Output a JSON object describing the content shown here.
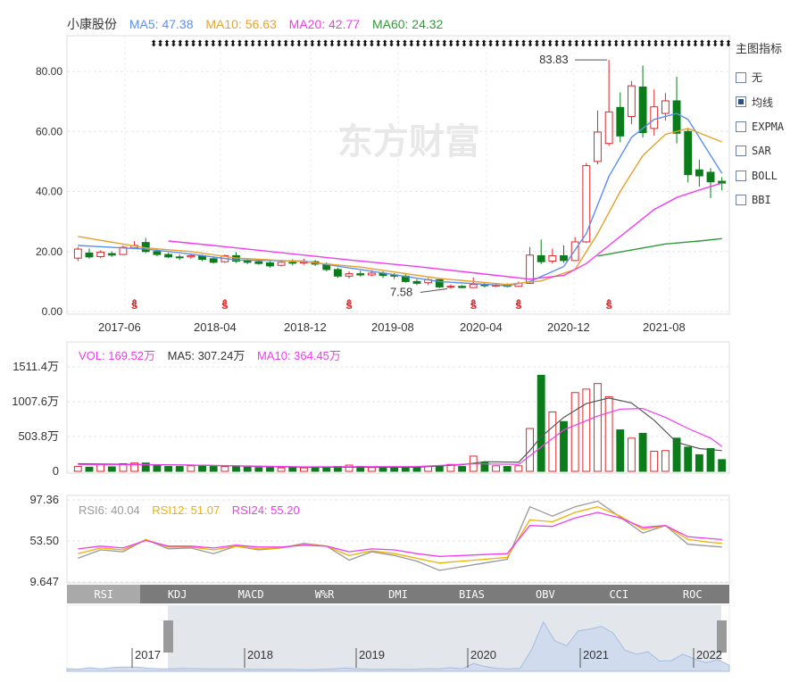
{
  "stock": {
    "name": "小康股份",
    "ma5": "MA5: 47.38",
    "ma10": "MA10: 56.63",
    "ma20": "MA20: 42.77",
    "ma60": "MA60: 24.32"
  },
  "colors": {
    "up": "#e0252b",
    "down": "#0a7d1a",
    "ma5": "#5b8ff0",
    "ma10": "#e6a22e",
    "ma20": "#f03cf0",
    "ma60": "#2f9a3a",
    "rsi6": "#999999",
    "rsi12": "#f0b000",
    "rsi24": "#f03cf0"
  },
  "side_panel": {
    "title": "主图指标",
    "options": [
      {
        "label": "无",
        "checked": false
      },
      {
        "label": "均线",
        "checked": true
      },
      {
        "label": "EXPMA",
        "checked": false
      },
      {
        "label": "SAR",
        "checked": false
      },
      {
        "label": "BOLL",
        "checked": false
      },
      {
        "label": "BBI",
        "checked": false
      }
    ]
  },
  "watermark": "东方财富",
  "volume_legend": {
    "vol": "VOL: 169.52万",
    "ma5": "MA5: 307.24万",
    "ma10": "MA10: 364.45万"
  },
  "rsi_legend": {
    "rsi6": "RSI6: 40.04",
    "rsi12": "RSI12: 51.07",
    "rsi24": "RSI24: 55.20"
  },
  "tabs": [
    "RSI",
    "KDJ",
    "MACD",
    "W%R",
    "DMI",
    "BIAS",
    "OBV",
    "CCI",
    "ROC"
  ],
  "active_tab": "RSI",
  "navigator_years": [
    "2017",
    "2018",
    "2019",
    "2020",
    "2021",
    "2022"
  ],
  "chart_data": [
    {
      "type": "candlestick",
      "y_ticks": [
        "80.00",
        "60.00",
        "40.00",
        "20.00",
        "0.00"
      ],
      "ylim": [
        0,
        90
      ],
      "x_ticks": [
        "2017-06",
        "2018-04",
        "2018-12",
        "2019-08",
        "2020-04",
        "2020-12",
        "2021-08"
      ],
      "annotations": [
        {
          "label": "83.83",
          "index": 47,
          "value": 83.83
        },
        {
          "label": "7.58",
          "index": 33,
          "value": 7.58
        }
      ],
      "dividend_marks": [
        5,
        13,
        24,
        35,
        39,
        47
      ],
      "candles": [
        [
          17.8,
          20.8,
          21.5,
          16.8
        ],
        [
          19.5,
          18.2,
          21.0,
          17.6
        ],
        [
          18.3,
          19.8,
          20.4,
          17.8
        ],
        [
          19.3,
          18.8,
          20.0,
          18.2
        ],
        [
          19.0,
          21.4,
          22.0,
          18.8
        ],
        [
          21.2,
          22.0,
          23.5,
          20.8
        ],
        [
          23.0,
          20.0,
          24.5,
          19.5
        ],
        [
          20.0,
          19.0,
          20.6,
          18.4
        ],
        [
          19.0,
          18.2,
          19.6,
          17.8
        ],
        [
          18.2,
          18.0,
          19.0,
          17.2
        ],
        [
          18.2,
          18.6,
          19.4,
          17.6
        ],
        [
          18.6,
          17.4,
          19.0,
          16.8
        ],
        [
          17.6,
          16.4,
          18.4,
          16.0
        ],
        [
          16.6,
          18.6,
          19.0,
          16.2
        ],
        [
          18.6,
          16.8,
          19.8,
          16.2
        ],
        [
          16.8,
          16.4,
          17.6,
          15.8
        ],
        [
          16.6,
          16.0,
          17.4,
          15.6
        ],
        [
          16.2,
          15.2,
          16.8,
          14.6
        ],
        [
          15.4,
          16.4,
          17.2,
          15.0
        ],
        [
          16.4,
          16.2,
          17.4,
          15.4
        ],
        [
          16.2,
          16.6,
          17.6,
          15.6
        ],
        [
          16.6,
          15.8,
          17.2,
          15.2
        ],
        [
          15.8,
          14.0,
          16.4,
          13.4
        ],
        [
          14.0,
          11.8,
          14.6,
          11.2
        ],
        [
          11.8,
          12.6,
          13.4,
          11.0
        ],
        [
          12.6,
          12.2,
          13.6,
          11.6
        ],
        [
          12.2,
          12.8,
          13.8,
          11.8
        ],
        [
          12.8,
          12.0,
          13.4,
          11.2
        ],
        [
          12.2,
          11.8,
          12.8,
          10.8
        ],
        [
          11.8,
          10.0,
          12.4,
          9.6
        ],
        [
          10.0,
          9.4,
          10.8,
          8.8
        ],
        [
          9.6,
          10.6,
          11.2,
          8.8
        ],
        [
          10.6,
          8.2,
          11.0,
          7.8
        ],
        [
          8.2,
          8.4,
          9.0,
          7.58
        ],
        [
          8.4,
          8.0,
          8.8,
          7.7
        ],
        [
          8.0,
          9.0,
          11.4,
          7.9
        ],
        [
          9.0,
          8.6,
          9.6,
          8.0
        ],
        [
          8.6,
          8.8,
          9.4,
          8.2
        ],
        [
          8.8,
          8.4,
          9.4,
          8.0
        ],
        [
          8.4,
          9.4,
          10.0,
          8.2
        ],
        [
          9.4,
          18.8,
          21.5,
          9.2
        ],
        [
          18.6,
          16.6,
          24.0,
          15.8
        ],
        [
          16.8,
          18.6,
          21.0,
          16.0
        ],
        [
          18.6,
          17.0,
          22.0,
          16.2
        ],
        [
          17.0,
          23.2,
          24.8,
          16.8
        ],
        [
          23.2,
          48.6,
          49.5,
          22.8
        ],
        [
          50.0,
          59.8,
          67.0,
          49.0
        ],
        [
          56.0,
          66.5,
          83.83,
          55.2
        ],
        [
          68.0,
          58.5,
          73.0,
          56.4
        ],
        [
          65.0,
          75.2,
          76.8,
          62.4
        ],
        [
          74.8,
          59.6,
          82.0,
          58.0
        ],
        [
          61.0,
          68.2,
          74.0,
          58.6
        ],
        [
          66.0,
          70.2,
          72.8,
          63.6
        ],
        [
          70.2,
          59.4,
          78.2,
          56.0
        ],
        [
          60.0,
          45.6,
          60.8,
          43.0
        ],
        [
          47.2,
          45.2,
          50.6,
          41.6
        ],
        [
          46.4,
          43.2,
          47.8,
          37.8
        ],
        [
          43.4,
          42.8,
          44.8,
          40.4
        ]
      ],
      "ma_lines": {
        "MA5": [
          [
            0,
            22.0
          ],
          [
            6,
            20.8
          ],
          [
            9,
            19.6
          ],
          [
            14,
            17.2
          ],
          [
            20,
            16.8
          ],
          [
            25,
            14.0
          ],
          [
            32,
            10.0
          ],
          [
            38,
            8.6
          ],
          [
            40,
            10.0
          ],
          [
            43,
            15.0
          ],
          [
            45,
            26.0
          ],
          [
            47,
            45.0
          ],
          [
            49,
            58.0
          ],
          [
            51,
            64.0
          ],
          [
            53,
            66.0
          ],
          [
            54,
            64.0
          ],
          [
            57,
            46.0
          ]
        ],
        "MA10": [
          [
            0,
            25.0
          ],
          [
            6,
            21.2
          ],
          [
            10,
            20.0
          ],
          [
            14,
            17.8
          ],
          [
            20,
            16.6
          ],
          [
            25,
            14.8
          ],
          [
            32,
            11.0
          ],
          [
            38,
            9.0
          ],
          [
            41,
            10.2
          ],
          [
            44,
            14.0
          ],
          [
            46,
            26.0
          ],
          [
            48,
            40.0
          ],
          [
            50,
            52.0
          ],
          [
            52,
            59.0
          ],
          [
            54,
            61.0
          ],
          [
            57,
            56.5
          ]
        ],
        "MA20": [
          [
            8,
            23.5
          ],
          [
            12,
            22.0
          ],
          [
            18,
            19.6
          ],
          [
            24,
            17.2
          ],
          [
            30,
            15.0
          ],
          [
            36,
            12.5
          ],
          [
            40,
            10.8
          ],
          [
            43,
            12.0
          ],
          [
            45,
            16.0
          ],
          [
            47,
            22.0
          ],
          [
            49,
            28.0
          ],
          [
            51,
            34.0
          ],
          [
            53,
            38.0
          ],
          [
            55,
            40.5
          ],
          [
            57,
            42.8
          ]
        ],
        "MA60": [
          [
            46,
            18.5
          ],
          [
            49,
            20.5
          ],
          [
            52,
            22.5
          ],
          [
            55,
            23.5
          ],
          [
            57,
            24.3
          ]
        ]
      }
    },
    {
      "type": "bar",
      "name": "VOL",
      "y_ticks": [
        "1511.4万",
        "1007.6万",
        "503.8万",
        "0"
      ],
      "ylim": [
        0,
        1511.4
      ],
      "values": [
        70,
        60,
        100,
        65,
        110,
        120,
        120,
        85,
        70,
        70,
        80,
        75,
        70,
        70,
        70,
        60,
        55,
        55,
        50,
        55,
        50,
        45,
        55,
        70,
        90,
        70,
        55,
        55,
        60,
        55,
        55,
        75,
        70,
        100,
        70,
        220,
        130,
        80,
        70,
        80,
        620,
        1390,
        860,
        720,
        1140,
        1190,
        1270,
        1080,
        600,
        480,
        550,
        290,
        300,
        480,
        350,
        240,
        330,
        169.52
      ],
      "ma_lines": {
        "MA5": [
          [
            0,
            110
          ],
          [
            10,
            90
          ],
          [
            20,
            60
          ],
          [
            30,
            60
          ],
          [
            34,
            95
          ],
          [
            36,
            140
          ],
          [
            39,
            130
          ],
          [
            40,
            300
          ],
          [
            41,
            500
          ],
          [
            43,
            780
          ],
          [
            45,
            980
          ],
          [
            47,
            1060
          ],
          [
            49,
            990
          ],
          [
            51,
            740
          ],
          [
            53,
            420
          ],
          [
            55,
            330
          ],
          [
            57,
            300
          ]
        ],
        "MA10": [
          [
            0,
            100
          ],
          [
            10,
            90
          ],
          [
            20,
            65
          ],
          [
            30,
            70
          ],
          [
            35,
            110
          ],
          [
            39,
            100
          ],
          [
            41,
            350
          ],
          [
            43,
            600
          ],
          [
            46,
            800
          ],
          [
            48,
            900
          ],
          [
            50,
            910
          ],
          [
            52,
            780
          ],
          [
            54,
            620
          ],
          [
            56,
            480
          ],
          [
            57,
            360
          ]
        ]
      }
    },
    {
      "type": "line",
      "name": "RSI",
      "y_ticks": [
        "97.36",
        "53.50",
        "9.647"
      ],
      "ylim": [
        9.647,
        97.36
      ],
      "x": [
        0,
        2,
        4,
        6,
        8,
        10,
        12,
        14,
        16,
        18,
        20,
        22,
        24,
        26,
        28,
        30,
        32,
        34,
        36,
        38,
        40,
        42,
        44,
        46,
        48,
        50,
        52,
        54,
        56,
        57
      ],
      "series": [
        {
          "name": "RSI6",
          "values": [
            35,
            44,
            42,
            55,
            45,
            46,
            40,
            48,
            44,
            46,
            51,
            48,
            33,
            42,
            38,
            32,
            22,
            26,
            30,
            34,
            90,
            80,
            90,
            96,
            79,
            62,
            70,
            50,
            48,
            47
          ]
        },
        {
          "name": "RSI12",
          "values": [
            40,
            46,
            44,
            55,
            47,
            47,
            44,
            48,
            45,
            46,
            50,
            48,
            38,
            43,
            40,
            35,
            30,
            32,
            34,
            36,
            76,
            74,
            84,
            90,
            80,
            66,
            70,
            55,
            52,
            51
          ]
        },
        {
          "name": "RSI24",
          "values": [
            45,
            48,
            46,
            54,
            48,
            48,
            46,
            49,
            47,
            47,
            49,
            48,
            42,
            45,
            44,
            40,
            37,
            38,
            39,
            40,
            70,
            69,
            78,
            84,
            78,
            68,
            70,
            58,
            56,
            55
          ]
        }
      ]
    }
  ]
}
